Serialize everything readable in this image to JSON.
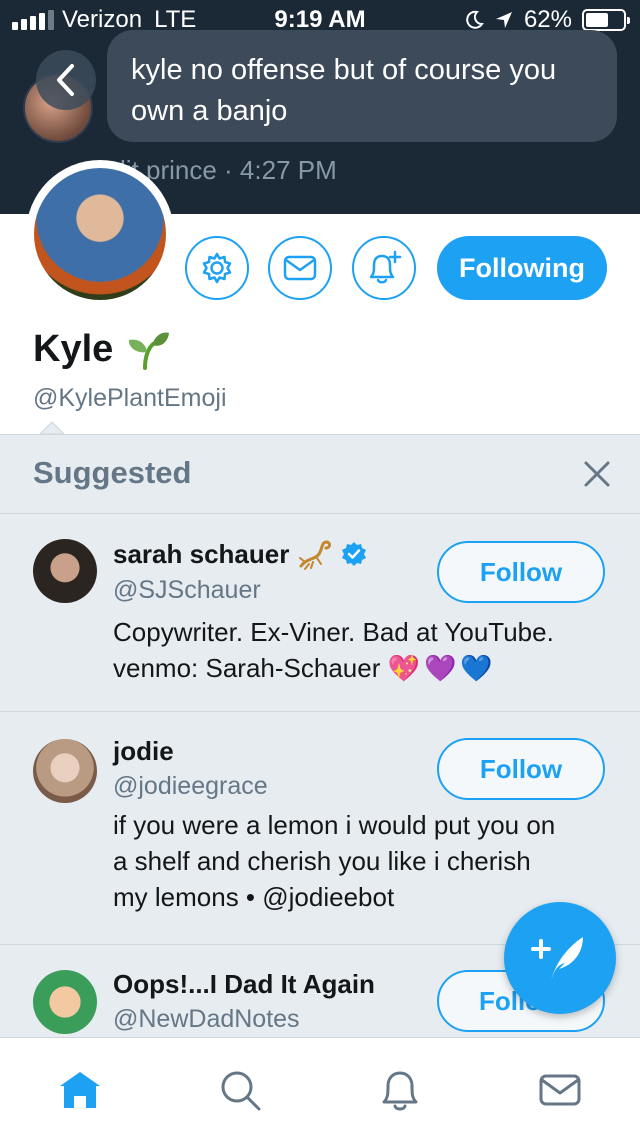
{
  "status_bar": {
    "carrier": "Verizon",
    "network": "LTE",
    "time": "9:19 AM",
    "battery": "62%",
    "battery_level": 0.62,
    "signal_bars": 4,
    "icons": [
      "moon-icon",
      "location-arrow-icon"
    ]
  },
  "dm_preview": {
    "message": "kyle no offense but of course you own a banjo",
    "meta": "lit prince · 4:27 PM",
    "back_icon": "chevron-left-icon"
  },
  "profile": {
    "name": "Kyle",
    "name_emoji": "🌱",
    "handle": "@KylePlantEmoji",
    "following_label": "Following",
    "action_icons": [
      "gear-icon",
      "envelope-icon",
      "bell-plus-icon"
    ]
  },
  "suggested": {
    "title": "Suggested",
    "close_icon": "close-icon",
    "accounts": [
      {
        "name": "sarah schauer",
        "name_emoji": "🦂",
        "verified": true,
        "handle": "@SJSchauer",
        "bio_line1": "Copywriter. Ex-Viner. Bad at YouTube.",
        "bio_line2": "venmo: Sarah-Schauer",
        "bio_emoji": "💖💜💙",
        "button": "Follow"
      },
      {
        "name": "jodie",
        "handle": "@jodieegrace",
        "bio_line1": "if you were a lemon i would put you on",
        "bio_line2": "a shelf and cherish you like i cherish",
        "bio_line3": "my lemons • @jodieebot",
        "button": "Follow"
      },
      {
        "name": "Oops!...I Dad It Again",
        "handle": "@NewDadNotes",
        "button": "Follow"
      }
    ]
  },
  "compose_icon": "compose-feather-plus-icon",
  "tabbar": {
    "tabs": [
      "home-icon",
      "search-icon",
      "notifications-bell-icon",
      "messages-envelope-icon"
    ],
    "active": "home-icon"
  },
  "colors": {
    "brand_blue": "#1da1f2",
    "header_bg": "#1b2836",
    "panel_bg": "#e6ecf0",
    "secondary_text": "#657786"
  }
}
